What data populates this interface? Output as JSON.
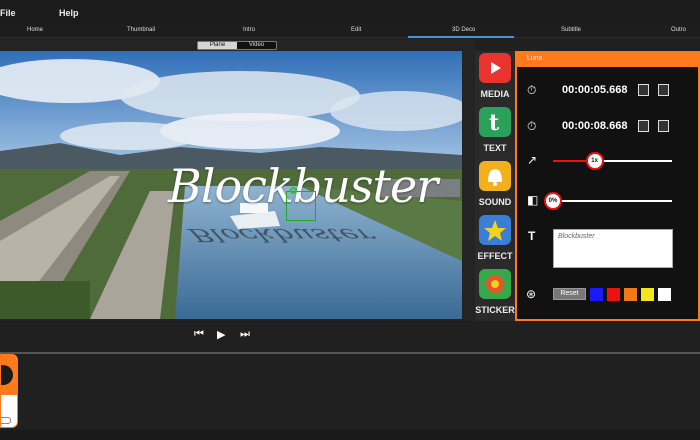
{
  "menu": {
    "file": "File",
    "help": "Help"
  },
  "tabs": [
    {
      "label": "Home"
    },
    {
      "label": "Thumbnail"
    },
    {
      "label": "Intro"
    },
    {
      "label": "Edit"
    },
    {
      "label": "3D Deco",
      "active": true
    },
    {
      "label": "Subtitle"
    },
    {
      "label": "Outro"
    }
  ],
  "viewport": {
    "mode_plane": "Plane",
    "mode_video": "Video",
    "overlay_text": "Blockbuster",
    "overlay_reflection": "Blockbuster"
  },
  "playback": {
    "prev_icon": "skip-back-icon",
    "play_icon": "play-icon",
    "next_icon": "skip-forward-icon"
  },
  "tools": [
    {
      "label": "MEDIA",
      "icon": "youtube-media-icon",
      "color": "#e8332f"
    },
    {
      "label": "TEXT",
      "icon": "text-t-icon",
      "color": "#2aa05a"
    },
    {
      "label": "SOUND",
      "icon": "bell-sound-icon",
      "color": "#f2b01c"
    },
    {
      "label": "EFFECT",
      "icon": "star-effect-icon",
      "color": "#3a7ed8"
    },
    {
      "label": "STICKER",
      "icon": "sticker-icon",
      "color": "#35a94a"
    }
  ],
  "panel": {
    "title": "Luna",
    "start_time": "00:00:05.668",
    "end_time": "00:00:08.668",
    "speed_label": "1x",
    "speed_value": 0.35,
    "opacity_label": "0%",
    "opacity_value": 0.0,
    "text_placeholder": "Blockbuster",
    "reset_label": "Reset",
    "swatches": [
      "#1a1aff",
      "#ee1111",
      "#f07a1a",
      "#f5e61a",
      "#ffffff"
    ],
    "accent": "#ff7a1a"
  }
}
